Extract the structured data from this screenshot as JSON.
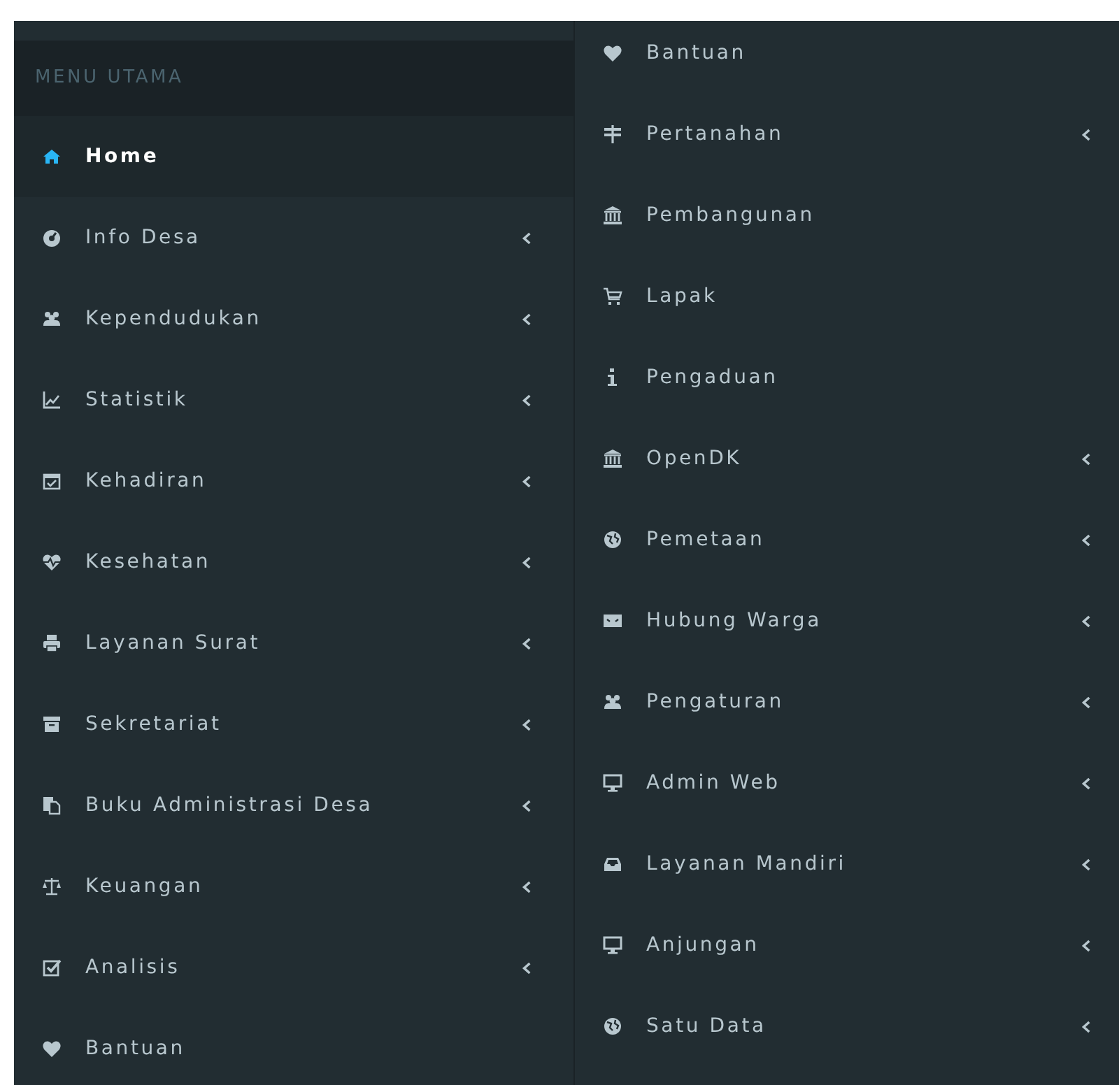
{
  "main_menu": {
    "header": "MENU UTAMA",
    "items": [
      {
        "label": "Home",
        "kind": "home",
        "selected": true,
        "has_submenu": false
      },
      {
        "label": "Info Desa",
        "kind": "gauge",
        "selected": false,
        "has_submenu": true
      },
      {
        "label": "Kependudukan",
        "kind": "users",
        "selected": false,
        "has_submenu": true
      },
      {
        "label": "Statistik",
        "kind": "chart",
        "selected": false,
        "has_submenu": true
      },
      {
        "label": "Kehadiran",
        "kind": "calendar",
        "selected": false,
        "has_submenu": true
      },
      {
        "label": "Kesehatan",
        "kind": "heartbeat",
        "selected": false,
        "has_submenu": true
      },
      {
        "label": "Layanan Surat",
        "kind": "printer",
        "selected": false,
        "has_submenu": true
      },
      {
        "label": "Sekretariat",
        "kind": "archive",
        "selected": false,
        "has_submenu": true
      },
      {
        "label": "Buku Administrasi Desa",
        "kind": "copy",
        "selected": false,
        "has_submenu": true
      },
      {
        "label": "Keuangan",
        "kind": "scale",
        "selected": false,
        "has_submenu": true
      },
      {
        "label": "Analisis",
        "kind": "checkbox",
        "selected": false,
        "has_submenu": true
      },
      {
        "label": "Bantuan",
        "kind": "heart",
        "selected": false,
        "has_submenu": false
      }
    ]
  },
  "second_menu": {
    "items": [
      {
        "label": "Bantuan",
        "kind": "heart",
        "selected": false,
        "has_submenu": false
      },
      {
        "label": "Pertanahan",
        "kind": "signpost",
        "selected": false,
        "has_submenu": true
      },
      {
        "label": "Pembangunan",
        "kind": "bank",
        "selected": false,
        "has_submenu": false
      },
      {
        "label": "Lapak",
        "kind": "cart",
        "selected": false,
        "has_submenu": false
      },
      {
        "label": "Pengaduan",
        "kind": "info",
        "selected": false,
        "has_submenu": false
      },
      {
        "label": "OpenDK",
        "kind": "bank",
        "selected": false,
        "has_submenu": true
      },
      {
        "label": "Pemetaan",
        "kind": "globe",
        "selected": false,
        "has_submenu": true
      },
      {
        "label": "Hubung Warga",
        "kind": "envelope",
        "selected": false,
        "has_submenu": true
      },
      {
        "label": "Pengaturan",
        "kind": "users",
        "selected": false,
        "has_submenu": true
      },
      {
        "label": "Admin Web",
        "kind": "monitor",
        "selected": false,
        "has_submenu": true
      },
      {
        "label": "Layanan Mandiri",
        "kind": "inbox",
        "selected": false,
        "has_submenu": true
      },
      {
        "label": "Anjungan",
        "kind": "monitor",
        "selected": false,
        "has_submenu": true
      },
      {
        "label": "Satu Data",
        "kind": "globe",
        "selected": false,
        "has_submenu": true
      }
    ]
  }
}
